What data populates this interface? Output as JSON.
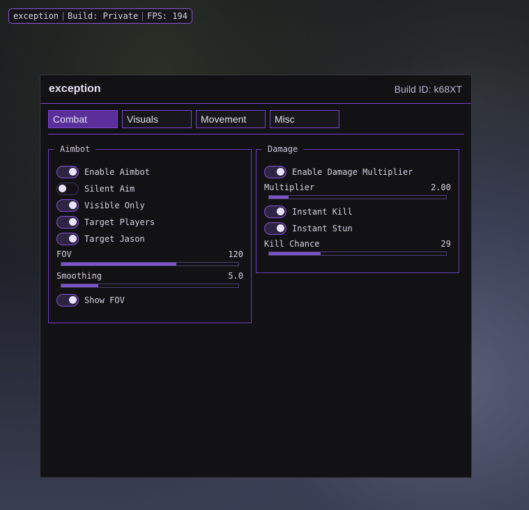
{
  "overlay": {
    "name": "exception",
    "build": "Build: Private",
    "fps": "FPS: 194"
  },
  "window": {
    "title": "exception",
    "build_id": "Build ID: k68XT"
  },
  "tabs": [
    {
      "label": "Combat",
      "active": true
    },
    {
      "label": "Visuals"
    },
    {
      "label": "Movement"
    },
    {
      "label": "Misc"
    }
  ],
  "aimbot": {
    "title": "Aimbot",
    "toggles": [
      {
        "label": "Enable Aimbot",
        "on": true
      },
      {
        "label": "Silent Aim",
        "on": false
      },
      {
        "label": "Visible Only",
        "on": true
      },
      {
        "label": "Target Players",
        "on": true
      },
      {
        "label": "Target Jason",
        "on": true
      }
    ],
    "fov": {
      "label": "FOV",
      "value": "120",
      "fraction": 0.65
    },
    "smoothing": {
      "label": "Smoothing",
      "value": "5.0",
      "fraction": 0.21
    },
    "show_fov": {
      "label": "Show FOV",
      "on": true
    }
  },
  "damage": {
    "title": "Damage",
    "enable": {
      "label": "Enable Damage Multiplier",
      "on": true
    },
    "multiplier": {
      "label": "Multiplier",
      "value": "2.00",
      "fraction": 0.11
    },
    "instant_kill": {
      "label": "Instant Kill",
      "on": true
    },
    "instant_stun": {
      "label": "Instant Stun",
      "on": true
    },
    "kill_chance": {
      "label": "Kill Chance",
      "value": "29",
      "fraction": 0.29
    }
  },
  "colors": {
    "accent": "#7a45d0",
    "panel": "#121114"
  }
}
